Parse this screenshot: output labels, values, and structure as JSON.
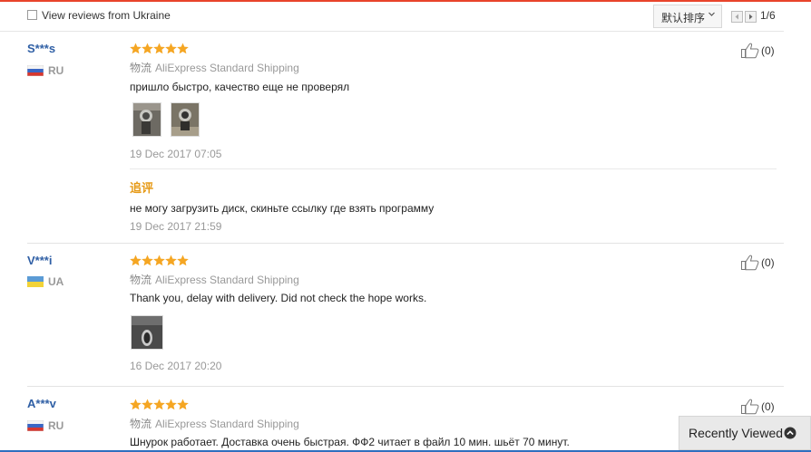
{
  "filter": {
    "checkbox_label": "View reviews from Ukraine",
    "sort_label": "默认排序",
    "pagination": "1/6"
  },
  "shipping_prefix": "物流",
  "reviews": [
    {
      "name": "S***s",
      "country": "RU",
      "rating": 5,
      "shipping": "AliExpress Standard Shipping",
      "text": "пришло быстро, качество еще не проверял",
      "date": "19 Dec 2017 07:05",
      "likes": "(0)",
      "additional": {
        "label": "追评",
        "text": "не могу загрузить диск, скиньте ссылку где взять программу",
        "date": "19 Dec 2017 21:59"
      }
    },
    {
      "name": "V***i",
      "country": "UA",
      "rating": 5,
      "shipping": "AliExpress Standard Shipping",
      "text": "Thank you, delay with delivery. Did not check the hope works.",
      "date": "16 Dec 2017 20:20",
      "likes": "(0)"
    },
    {
      "name": "A***v",
      "country": "RU",
      "rating": 5,
      "shipping": "AliExpress Standard Shipping",
      "text": "Шнурок работает. Доставка очень быстрая. ФФ2 читает в файл 10 мин. шьёт 70 минут.",
      "likes": "(0)"
    }
  ],
  "recently_viewed": "Recently Viewed",
  "colors": {
    "accent_orange": "#f5a623",
    "name_blue": "#2f5fa5",
    "muted": "#999999",
    "top_line": "#e8442b"
  },
  "icons": [
    "checkbox-icon",
    "chevron-down-icon",
    "prev-page-icon",
    "next-page-icon",
    "star-icon",
    "thumbs-up-icon",
    "flag-ru-icon",
    "flag-ua-icon",
    "chevron-up-circle-icon"
  ]
}
